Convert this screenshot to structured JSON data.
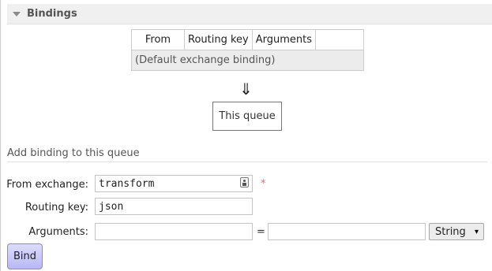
{
  "section": {
    "title": "Bindings",
    "collapse_icon": "triangle-down-icon"
  },
  "bindings_table": {
    "columns": [
      "From",
      "Routing key",
      "Arguments",
      ""
    ],
    "default_row": "(Default exchange binding)"
  },
  "flow": {
    "arrow": "⇓",
    "queue_label": "This queue"
  },
  "add_binding": {
    "title": "Add binding to this queue",
    "from_exchange_label": "From exchange:",
    "from_exchange_value": "transform",
    "exchange_picker_icon": "address-book-icon",
    "required_marker": "*",
    "routing_key_label": "Routing key:",
    "routing_key_value": "json",
    "arguments_label": "Arguments:",
    "argument_key_value": "",
    "equals_sign": "=",
    "argument_value_value": "",
    "argument_type_selected": "String",
    "select_caret": "▾",
    "bind_button_label": "Bind"
  },
  "colors": {
    "header_bg": "#f0f0f0",
    "row_bg": "#ececec",
    "button_bg": "#c8c8f8",
    "required": "#ff6060"
  }
}
